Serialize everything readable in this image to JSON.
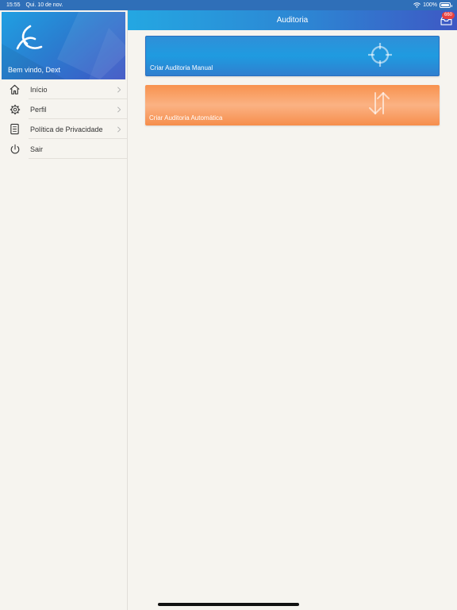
{
  "status_bar": {
    "time": "15:55",
    "date": "Qui. 10 de nov.",
    "battery": "100%"
  },
  "sidebar": {
    "welcome": "Bem vindo, Dext",
    "items": [
      {
        "label": "Início",
        "icon": "home-icon",
        "has_chevron": true
      },
      {
        "label": "Perfil",
        "icon": "gear-icon",
        "has_chevron": true
      },
      {
        "label": "Política de Privacidade",
        "icon": "document-icon",
        "has_chevron": true
      },
      {
        "label": "Sair",
        "icon": "power-icon",
        "has_chevron": false
      }
    ]
  },
  "nav": {
    "title": "Auditoria",
    "badge": "660"
  },
  "cards": {
    "manual": {
      "label": "Criar Auditoria Manual",
      "icon": "crosshair-icon",
      "color": "#2a8fd9"
    },
    "auto": {
      "label": "Criar Auditoria Automática",
      "icon": "transfer-arrows-icon",
      "color": "#f8924f"
    }
  }
}
